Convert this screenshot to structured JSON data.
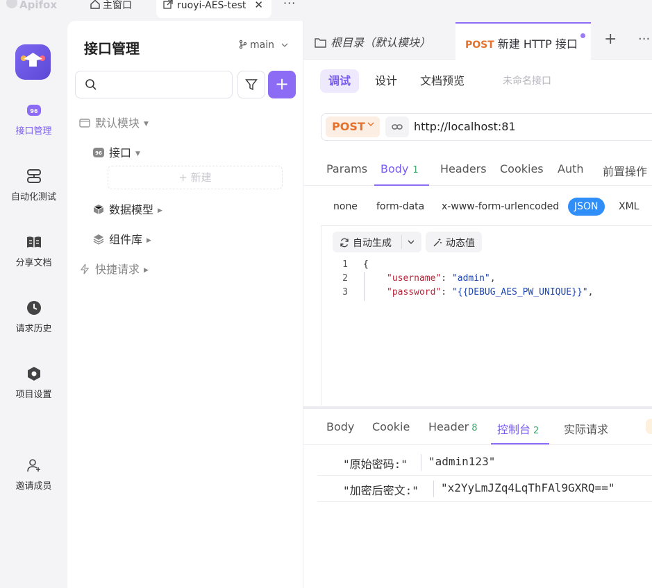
{
  "topbar": {
    "app_name": "Apifox",
    "home_label": "主窗口",
    "project_tab": "ruoyi-AES-test",
    "close": "✕",
    "more": "···"
  },
  "rail": {
    "items": [
      {
        "label": "接口管理",
        "icon": "api-icon",
        "active": true
      },
      {
        "label": "自动化测试",
        "icon": "automation-icon"
      },
      {
        "label": "分享文档",
        "icon": "book-icon"
      },
      {
        "label": "请求历史",
        "icon": "clock-icon"
      },
      {
        "label": "项目设置",
        "icon": "settings-hex-icon"
      },
      {
        "label": "邀请成员",
        "icon": "add-user-icon"
      }
    ]
  },
  "left_panel": {
    "title": "接口管理",
    "branch": "main",
    "search_placeholder": "",
    "add": "+",
    "tree": {
      "default_module": "默认模块",
      "api_folder": "接口",
      "new_label": "新建",
      "new_plus": "+",
      "data_model": "数据模型",
      "components": "组件库",
      "quick_request": "快捷请求"
    }
  },
  "main": {
    "root_tab": "根目录（默认模块）",
    "active_tab": {
      "method": "POST",
      "title": "新建 HTTP 接口"
    },
    "plus": "+",
    "more": "···",
    "subtabs": {
      "debug": "调试",
      "design": "设计",
      "preview": "文档预览",
      "unnamed": "未命名接口"
    },
    "request": {
      "method": "POST",
      "url": "http://localhost:81"
    },
    "request_tabs": {
      "params": "Params",
      "body": "Body",
      "body_badge": "1",
      "headers": "Headers",
      "cookies": "Cookies",
      "auth": "Auth",
      "pre": "前置操作"
    },
    "body_types": {
      "none": "none",
      "form_data": "form-data",
      "urlencoded": "x-www-form-urlencoded",
      "json": "JSON",
      "xml": "XML"
    },
    "editor": {
      "auto_generate": "自动生成",
      "dynamic_value": "动态值",
      "line_numbers": [
        "1",
        "2",
        "3"
      ],
      "line1": "{",
      "line2_key": "\"username\"",
      "line2_colon": ": ",
      "line2_val": "\"admin\"",
      "line2_end": ",",
      "line3_key": "\"password\"",
      "line3_colon": ": ",
      "line3_val": "\"{{DEBUG_AES_PW_UNIQUE}}\"",
      "line3_end": ","
    },
    "response_tabs": {
      "body": "Body",
      "cookie": "Cookie",
      "header": "Header",
      "header_badge": "8",
      "console": "控制台",
      "console_badge": "2",
      "actual": "实际请求"
    },
    "console": [
      {
        "key": "\"原始密码:\"",
        "value": "\"admin123\""
      },
      {
        "key": "\"加密后密文:\"",
        "value": "\"x2YyLmJZq4LqThFAl9GXRQ==\""
      }
    ]
  }
}
